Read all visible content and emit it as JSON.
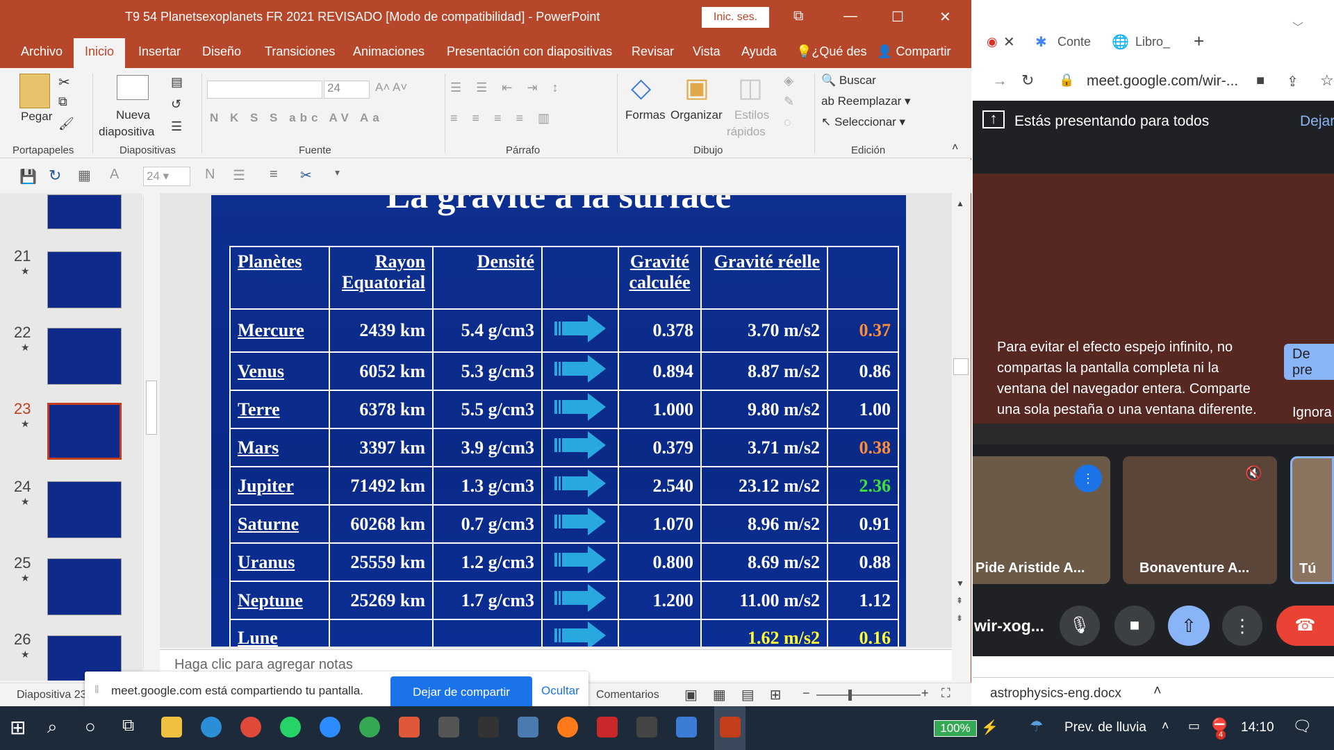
{
  "ppt": {
    "title": "T9 54 Planetsexoplanets FR 2021  REVISADO [Modo de compatibilidad]  -  PowerPoint",
    "signin": "Inic. ses.",
    "menu": [
      "Archivo",
      "Inicio",
      "Insertar",
      "Diseño",
      "Transiciones",
      "Animaciones",
      "Presentación con diapositivas",
      "Revisar",
      "Vista",
      "Ayuda",
      "¿Qué des",
      "Compartir"
    ],
    "ribbon": {
      "paste": "Pegar",
      "new_slide_1": "Nueva",
      "new_slide_2": "diapositiva",
      "font_size": "24",
      "font_buttons": "N K S S abc AV Aa",
      "shapes": "Formas",
      "arrange": "Organizar",
      "styles_1": "Estilos",
      "styles_2": "rápidos",
      "find": "Buscar",
      "replace": "Reemplazar",
      "select": "Seleccionar",
      "groups": [
        "Portapapeles",
        "Diapositivas",
        "Fuente",
        "Párrafo",
        "Dibujo",
        "Edición"
      ]
    },
    "qat_font_size": "24",
    "thumbs": [
      {
        "num": "21",
        "star": "★"
      },
      {
        "num": "22",
        "star": "★"
      },
      {
        "num": "23",
        "star": "★"
      },
      {
        "num": "24",
        "star": "★"
      },
      {
        "num": "25",
        "star": "★"
      },
      {
        "num": "26",
        "star": "★"
      }
    ],
    "slide": {
      "title": "La gravité à la surface",
      "headers": [
        "Planètes",
        "Rayon Equatorial",
        "Densité",
        "",
        "Gravité calculée",
        "Gravité réelle",
        ""
      ],
      "rows": [
        {
          "planet": "Mercure",
          "radius": "2439 km",
          "density": "5.4 g/cm3",
          "calc": "0.378",
          "real": "3.70 m/s2",
          "ratio": "0.37",
          "ratio_color": "#ff8c3a"
        },
        {
          "planet": "Venus",
          "radius": "6052 km",
          "density": "5.3 g/cm3",
          "calc": "0.894",
          "real": "8.87 m/s2",
          "ratio": "0.86",
          "ratio_color": "#ffffff"
        },
        {
          "planet": "Terre",
          "radius": "6378 km",
          "density": "5.5 g/cm3",
          "calc": "1.000",
          "real": "9.80 m/s2",
          "ratio": "1.00",
          "ratio_color": "#ffffff"
        },
        {
          "planet": "Mars",
          "radius": "3397 km",
          "density": "3.9 g/cm3",
          "calc": "0.379",
          "real": "3.71 m/s2",
          "ratio": "0.38",
          "ratio_color": "#ff8c3a"
        },
        {
          "planet": "Jupiter",
          "radius": "71492 km",
          "density": "1.3 g/cm3",
          "calc": "2.540",
          "real": "23.12 m/s2",
          "ratio": "2.36",
          "ratio_color": "#3be23b"
        },
        {
          "planet": "Saturne",
          "radius": "60268 km",
          "density": "0.7 g/cm3",
          "calc": "1.070",
          "real": "8.96 m/s2",
          "ratio": "0.91",
          "ratio_color": "#ffffff"
        },
        {
          "planet": "Uranus",
          "radius": "25559 km",
          "density": "1.2 g/cm3",
          "calc": "0.800",
          "real": "8.69 m/s2",
          "ratio": "0.88",
          "ratio_color": "#ffffff"
        },
        {
          "planet": "Neptune",
          "radius": "25269 km",
          "density": "1.7 g/cm3",
          "calc": "1.200",
          "real": "11.00 m/s2",
          "ratio": "1.12",
          "ratio_color": "#ffffff"
        },
        {
          "planet": "Lune",
          "radius": "",
          "density": "",
          "calc": "",
          "real": "1.62 m/s2",
          "ratio": "0.16",
          "ratio_color": "#ffff33"
        }
      ]
    },
    "notes_placeholder": "Haga clic para agregar notas",
    "status_slide": "Diapositiva 23",
    "status_comments": "Comentarios"
  },
  "sharebar": {
    "text": "meet.google.com está compartiendo tu pantalla.",
    "stop": "Dejar de compartir",
    "hide": "Ocultar"
  },
  "chrome": {
    "tab1": "Conte",
    "tab2": "Libro_",
    "url": "meet.google.com/wir-...",
    "presenting": "Estás presentando para todos",
    "stop_short": "Dejar",
    "warning": "Para evitar el efecto espejo infinito, no compartas la pantalla completa ni la ventana del navegador entera. Comparte una sola pestaña o una ventana diferente.",
    "share_btn_1": "De",
    "share_btn_2": "pre",
    "ignore": "Ignora",
    "participants": [
      "Pide Aristide A...",
      "Bonaventure A...",
      "Tú"
    ],
    "meeting_code": "wir-xog...",
    "download": "astrophysics-eng.docx"
  },
  "taskbar": {
    "battery": "100%",
    "weather": "Prev. de lluvia",
    "time": "14:10",
    "notif_badge": "4"
  }
}
